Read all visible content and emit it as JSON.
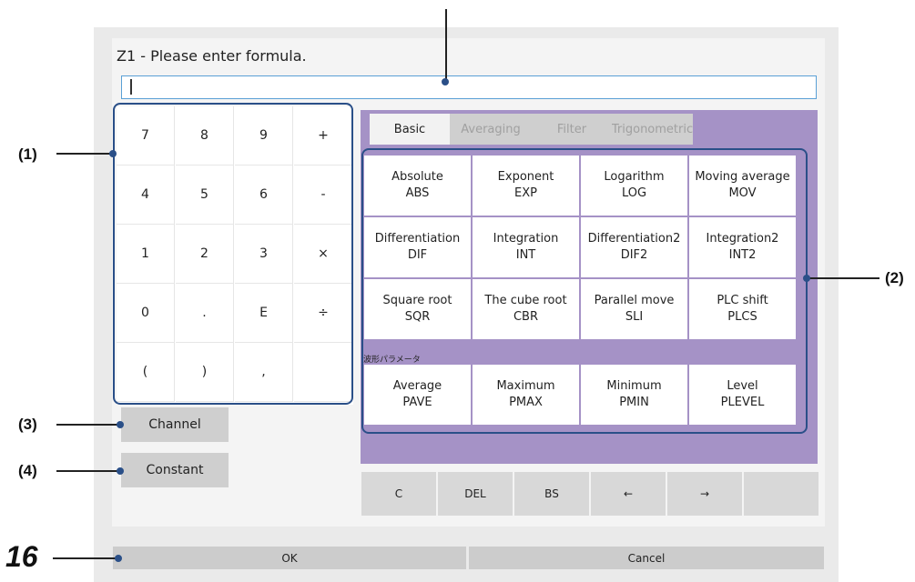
{
  "dialog": {
    "title": "Z1 - Please enter formula.",
    "formula_value": ""
  },
  "callouts": {
    "keypad": "(1)",
    "functions": "(2)",
    "channel": "(3)",
    "constant": "(4)",
    "page_number": "16"
  },
  "keypad": {
    "keys": [
      [
        "7",
        "8",
        "9",
        "+"
      ],
      [
        "4",
        "5",
        "6",
        "-"
      ],
      [
        "1",
        "2",
        "3",
        "×"
      ],
      [
        "0",
        ".",
        "E",
        "÷"
      ],
      [
        "(",
        ")",
        ",",
        ""
      ]
    ]
  },
  "side_buttons": {
    "channel": "Channel",
    "constant": "Constant"
  },
  "tabs": [
    {
      "label": "Basic",
      "active": true
    },
    {
      "label": "Averaging",
      "active": false
    },
    {
      "label": "Filter",
      "active": false
    },
    {
      "label": "Trigonometric",
      "active": false
    }
  ],
  "functions": [
    {
      "name": "Absolute",
      "code": "ABS"
    },
    {
      "name": "Exponent",
      "code": "EXP"
    },
    {
      "name": "Logarithm",
      "code": "LOG"
    },
    {
      "name": "Moving average",
      "code": "MOV"
    },
    {
      "name": "Differentiation",
      "code": "DIF"
    },
    {
      "name": "Integration",
      "code": "INT"
    },
    {
      "name": "Differentiation2",
      "code": "DIF2"
    },
    {
      "name": "Integration2",
      "code": "INT2"
    },
    {
      "name": "Square root",
      "code": "SQR"
    },
    {
      "name": "The cube root",
      "code": "CBR"
    },
    {
      "name": "Parallel move",
      "code": "SLI"
    },
    {
      "name": "PLC shift",
      "code": "PLCS"
    }
  ],
  "waveform_params": {
    "category_label": "波形パラメータ",
    "items": [
      {
        "name": "Average",
        "code": "PAVE"
      },
      {
        "name": "Maximum",
        "code": "PMAX"
      },
      {
        "name": "Minimum",
        "code": "PMIN"
      },
      {
        "name": "Level",
        "code": "PLEVEL"
      }
    ]
  },
  "edit_buttons": [
    "C",
    "DEL",
    "BS",
    "←",
    "→",
    ""
  ],
  "dialog_buttons": {
    "ok": "OK",
    "cancel": "Cancel"
  },
  "colors": {
    "accent_purple": "#a592c6",
    "callout_blue": "#2a4f88",
    "input_border": "#5aa0d6"
  }
}
